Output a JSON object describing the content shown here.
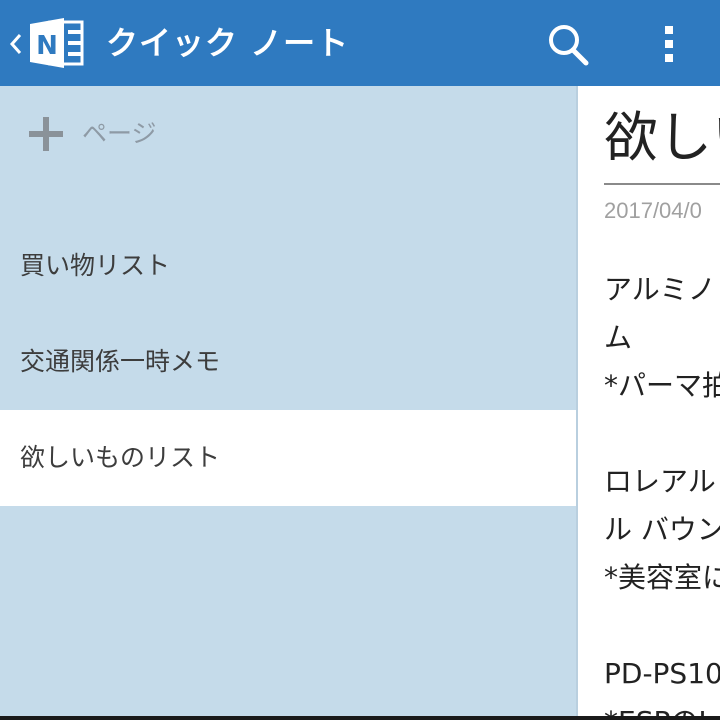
{
  "appbar": {
    "title": "クイック ノート",
    "logo_letter": "N",
    "icons": {
      "back": "chevron-left-icon",
      "logo": "onenote-logo-icon",
      "search": "search-icon",
      "overflow": "more-vert-icon"
    },
    "color": "#2f7ac0"
  },
  "sidebar": {
    "add_page_label": "ページ",
    "pages": [
      {
        "label": "買い物リスト",
        "selected": false
      },
      {
        "label": "交通関係一時メモ",
        "selected": false
      },
      {
        "label": "欲しいものリスト",
        "selected": true
      }
    ],
    "background": "#c5dbea"
  },
  "note": {
    "title": "欲しいものリスト",
    "date": "2017/04/0",
    "lines": [
      "アルミノ",
      "ム",
      "*パーマ拍",
      "",
      "ロレアル",
      "ル バウン",
      "*美容室に",
      "",
      "PD-PS10",
      "*ESPのI"
    ]
  }
}
